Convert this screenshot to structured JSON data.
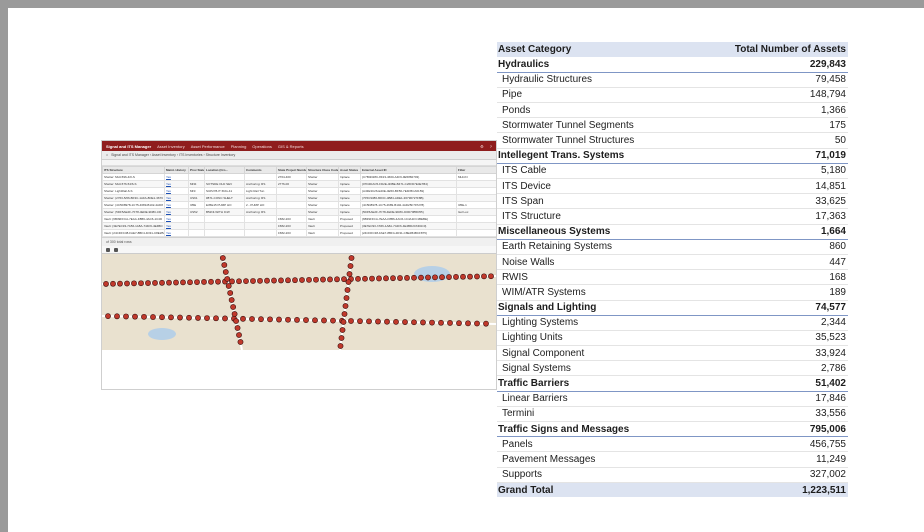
{
  "app": {
    "brand": "Signal and ITS Manager",
    "menu": [
      "Asset Inventory",
      "Asset Performance",
      "Planning",
      "Operations",
      "GIS & Reports"
    ],
    "breadcrumb": "Signal and ITS Manager › Asset Inventory › ITS Inventories › Structure Inventory",
    "grid_columns": [
      "ITS Structure",
      "Maint. History",
      "Prov State",
      "Location (Cro...",
      "Comments",
      "State Project Number",
      "Structure Class Code",
      "Asset Status",
      "External Asset ID",
      "Filter"
    ],
    "grid_rows": [
      [
        "Shelter: MHI-596-4/0-S",
        "Yes",
        "",
        "",
        "",
        "2764-400",
        "Shelter",
        "Inplace",
        "{C7B4D28C-8F23-4660-A4F9-9E5882703}",
        "MHI-IN"
      ],
      [
        "Shelter: MHI-576-54/6-S",
        "Yes",
        "MNIt",
        "SOTSDE OLD SEV",
        "Anchoring: RS",
        "2776-00",
        "Shelter",
        "Inplace",
        "{07D4DAC5-FD2E-4DBE-B471-C26FD7E4E7B4}",
        ""
      ],
      [
        "Shelter: LightRail-6-S",
        "Yes",
        "MNI",
        "SUP278-IT 6NG-41",
        "Light Rail Tun",
        "",
        "Shelter",
        "Inplace",
        "{A43E3C26-E20E-4E50-BF56-7E4FBCA6159}",
        ""
      ],
      [
        "Shelter: (2763-5/06-BF3C-1AFA-8DE1-3676",
        "Yes",
        "US61",
        "#871-CONC SHELT",
        "Anchoring: RS",
        "",
        "Shelter",
        "Inplace",
        "{7F5C9386-8FDC-4B84-ADE1-36796727F8B}",
        ""
      ],
      [
        "Shelter: (4C5D8978-1C75-4689-B102-4AD8",
        "Yes",
        "I35E",
        "E35E15 PUMP HO",
        "2 - PUMP HO",
        "",
        "Shelter",
        "Inplace",
        "{4C5D8978-1C75-4689-B102-4AD25F797278}",
        "I35E-1"
      ],
      [
        "Shelter: (5DF5AE2F-7F78-4EDE-9D8C-D0",
        "Yes",
        "US52",
        "B52NI-WITH ICW",
        "Anchoring: RS",
        "",
        "Shelter",
        "Inplace",
        "{5DF5AE2F-7F78-4EDE-9D8C-D0D70B5D55}",
        "Isol Loc"
      ],
      [
        "Vault: {6B39FFCA-7EAA-F8B6-4AC6-1C4D",
        "Yes",
        "",
        "",
        "",
        "1582-203",
        "Vault",
        "Proposed",
        "{6B39FFCA-7EAA-F8B6-4AC6-1C4A1FC1BEBE}",
        ""
      ],
      [
        "Vault: {3E7EC93-7A56-1A8A-744F6-4E4BD",
        "Yes",
        "",
        "",
        "",
        "1582-203",
        "Vault",
        "Proposed",
        "{3E7EC93-7A56-1A8A-744F6-4E4BD2C6D4C0}",
        ""
      ],
      [
        "Vault: {24CDFC38-FAE7-8BF4-4D31-C8E2B4",
        "Yes",
        "",
        "",
        "",
        "1582-203",
        "Vault",
        "Proposed",
        "{24CDFC38-FAE7-8BF4-4D31-C8E2B4BCF875}",
        ""
      ]
    ],
    "grid_footer": "of 300 total rows"
  },
  "table": {
    "header": {
      "category": "Asset Category",
      "total": "Total Number of Assets"
    },
    "rows": [
      {
        "kind": "cat",
        "label": "Hydraulics",
        "value": "229,843"
      },
      {
        "kind": "item",
        "label": "Hydraulic Structures",
        "value": "79,458"
      },
      {
        "kind": "item",
        "label": "Pipe",
        "value": "148,794"
      },
      {
        "kind": "item",
        "label": "Ponds",
        "value": "1,366"
      },
      {
        "kind": "item",
        "label": "Stormwater Tunnel Segments",
        "value": "175"
      },
      {
        "kind": "item",
        "label": "Stormwater Tunnel Structures",
        "value": "50"
      },
      {
        "kind": "cat",
        "label": "Intellegent Trans. Systems",
        "value": "71,019"
      },
      {
        "kind": "item",
        "label": "ITS Cable",
        "value": "5,180"
      },
      {
        "kind": "item",
        "label": "ITS Device",
        "value": "14,851"
      },
      {
        "kind": "item",
        "label": "ITS Span",
        "value": "33,625"
      },
      {
        "kind": "item",
        "label": "ITS Structure",
        "value": "17,363"
      },
      {
        "kind": "cat",
        "label": "Miscellaneous Systems",
        "value": "1,664"
      },
      {
        "kind": "item",
        "label": "Earth Retaining Systems",
        "value": "860"
      },
      {
        "kind": "item",
        "label": "Noise Walls",
        "value": "447"
      },
      {
        "kind": "item",
        "label": "RWIS",
        "value": "168"
      },
      {
        "kind": "item",
        "label": "WIM/ATR Systems",
        "value": "189"
      },
      {
        "kind": "cat",
        "label": "Signals and Lighting",
        "value": "74,577"
      },
      {
        "kind": "item",
        "label": "Lighting Systems",
        "value": "2,344"
      },
      {
        "kind": "item",
        "label": "Lighting Units",
        "value": "35,523"
      },
      {
        "kind": "item",
        "label": "Signal Component",
        "value": "33,924"
      },
      {
        "kind": "item",
        "label": "Signal Systems",
        "value": "2,786"
      },
      {
        "kind": "cat",
        "label": "Traffic Barriers",
        "value": "51,402"
      },
      {
        "kind": "item",
        "label": "Linear Barriers",
        "value": "17,846"
      },
      {
        "kind": "item",
        "label": "Termini",
        "value": "33,556"
      },
      {
        "kind": "cat",
        "label": "Traffic Signs and Messages",
        "value": "795,006"
      },
      {
        "kind": "item",
        "label": "Panels",
        "value": "456,755"
      },
      {
        "kind": "item",
        "label": "Pavement Messages",
        "value": "11,249"
      },
      {
        "kind": "item",
        "label": "Supports",
        "value": "327,002"
      },
      {
        "kind": "total",
        "label": "Grand Total",
        "value": "1,223,511"
      }
    ]
  },
  "colors": {
    "app_header": "#8f1d1d",
    "table_header": "#dce3f1",
    "category_rule": "#7f96c5",
    "map_marker": "#c0392b"
  }
}
